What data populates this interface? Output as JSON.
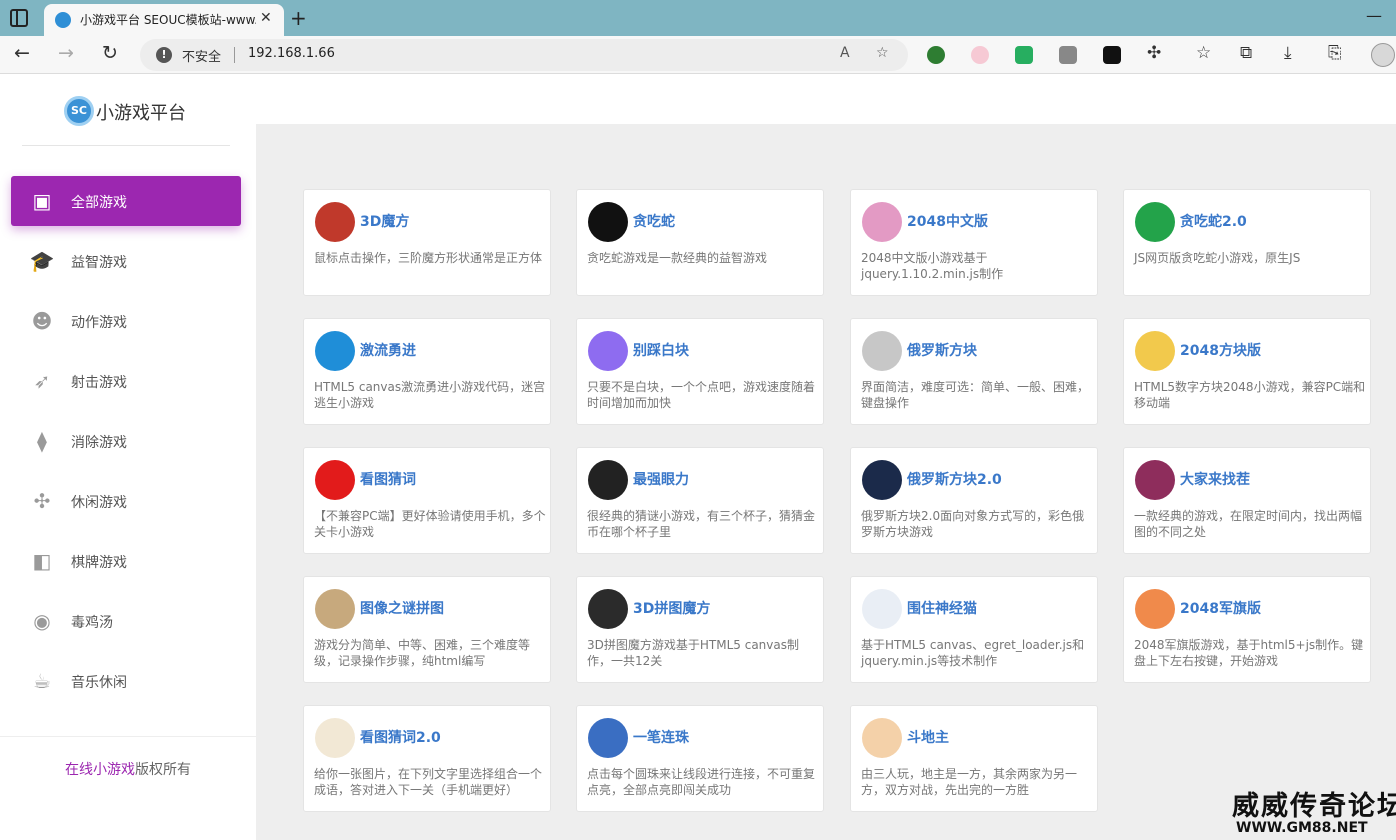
{
  "browser": {
    "tab_title": "小游戏平台 SEOUC模板站-www.s",
    "tab_close": "✕",
    "new_tab": "+",
    "window_min": "—",
    "insecure_label": "不安全",
    "url": "192.168.1.66"
  },
  "site": {
    "logo_mark": "SC",
    "logo_text": "小游戏平台"
  },
  "menu": [
    {
      "label": "全部游戏",
      "icon": "twitch-icon",
      "glyph": "▣",
      "active": true
    },
    {
      "label": "益智游戏",
      "icon": "graduation-cap-icon",
      "glyph": "🎓",
      "active": false
    },
    {
      "label": "动作游戏",
      "icon": "reddit-robot-icon",
      "glyph": "☻",
      "active": false
    },
    {
      "label": "射击游戏",
      "icon": "rocket-icon",
      "glyph": "➶",
      "active": false
    },
    {
      "label": "消除游戏",
      "icon": "cube-icon",
      "glyph": "⧫",
      "active": false
    },
    {
      "label": "休闲游戏",
      "icon": "pinwheel-icon",
      "glyph": "✣",
      "active": false
    },
    {
      "label": "棋牌游戏",
      "icon": "board-icon",
      "glyph": "◧",
      "active": false
    },
    {
      "label": "毒鸡汤",
      "icon": "user-circle-icon",
      "glyph": "◉",
      "active": false
    },
    {
      "label": "音乐休闲",
      "icon": "coffee-icon",
      "glyph": "☕",
      "active": false
    }
  ],
  "footer": {
    "link": "在线小游戏",
    "rest": "版权所有"
  },
  "games": [
    {
      "title": "3D魔方",
      "desc": "鼠标点击操作，三阶魔方形状通常是正方体",
      "icon": "rubik-cube-icon",
      "color": "#c0392b"
    },
    {
      "title": "贪吃蛇",
      "desc": "贪吃蛇游戏是一款经典的益智游戏",
      "icon": "snake-icon",
      "color": "#111111"
    },
    {
      "title": "2048中文版",
      "desc": "2048中文版小游戏基于jquery.1.10.2.min.js制作",
      "icon": "2048-icon",
      "color": "#e39ac4"
    },
    {
      "title": "贪吃蛇2.0",
      "desc": "JS网页版贪吃蛇小游戏，原生JS",
      "icon": "snake2-icon",
      "color": "#23a34a"
    },
    {
      "title": "激流勇进",
      "desc": "HTML5 canvas激流勇进小游戏代码，迷宫逃生小游戏",
      "icon": "stairs-icon",
      "color": "#1f8ed8"
    },
    {
      "title": "别踩白块",
      "desc": "只要不是白块，一个个点吧，游戏速度随着时间增加而加快",
      "icon": "piano-tile-icon",
      "color": "#8e6cf0"
    },
    {
      "title": "俄罗斯方块",
      "desc": "界面简洁，难度可选：简单、一般、困难，键盘操作",
      "icon": "tetris-icon",
      "color": "#c7c7c7"
    },
    {
      "title": "2048方块版",
      "desc": "HTML5数字方块2048小游戏，兼容PC端和移动端",
      "icon": "2048-blocks-icon",
      "color": "#f2c94c"
    },
    {
      "title": "看图猜词",
      "desc": "【不兼容PC端】更好体验请使用手机，多个关卡小游戏",
      "icon": "bottle-icon",
      "color": "#e21b1b"
    },
    {
      "title": "最强眼力",
      "desc": "很经典的猜谜小游戏，有三个杯子，猜猜金币在哪个杯子里",
      "icon": "cup-icon",
      "color": "#222222"
    },
    {
      "title": "俄罗斯方块2.0",
      "desc": "俄罗斯方块2.0面向对象方式写的，彩色俄罗斯方块游戏",
      "icon": "tetris2-icon",
      "color": "#1b2a4a"
    },
    {
      "title": "大家来找茬",
      "desc": "一款经典的游戏，在限定时间内，找出两幅图的不同之处",
      "icon": "heart-icon",
      "color": "#8e2d5c"
    },
    {
      "title": "图像之谜拼图",
      "desc": "游戏分为简单、中等、困难，三个难度等级，记录操作步骤，纯html编写",
      "icon": "puzzle-icon",
      "color": "#c7a97d"
    },
    {
      "title": "3D拼图魔方",
      "desc": "3D拼图魔方游戏基于HTML5 canvas制作，一共12关",
      "icon": "cube-puzzle-icon",
      "color": "#2b2b2b"
    },
    {
      "title": "围住神经猫",
      "desc": "基于HTML5 canvas、egret_loader.js和jquery.min.js等技术制作",
      "icon": "cat-icon",
      "color": "#e9eef5"
    },
    {
      "title": "2048军旗版",
      "desc": "2048军旗版游戏，基于html5+js制作。键盘上下左右按键，开始游戏",
      "icon": "army-flag-icon",
      "color": "#f08a4b"
    },
    {
      "title": "看图猜词2.0",
      "desc": "给你一张图片，在下列文字里选择组合一个成语，答对进入下一关（手机端更好）",
      "icon": "eye-icon",
      "color": "#f2e8d5"
    },
    {
      "title": "一笔连珠",
      "desc": "点击每个圆珠来让线段进行连接，不可重复点亮，全部点亮即闯关成功",
      "icon": "ball-icon",
      "color": "#3a6ec2"
    },
    {
      "title": "斗地主",
      "desc": "由三人玩，地主是一方，其余两家为另一方，双方对战，先出完的一方胜",
      "icon": "farmer-icon",
      "color": "#f4d1a9"
    }
  ],
  "watermark": {
    "cn": "威威传奇论坛",
    "url": "WWW.GM88.NET"
  }
}
